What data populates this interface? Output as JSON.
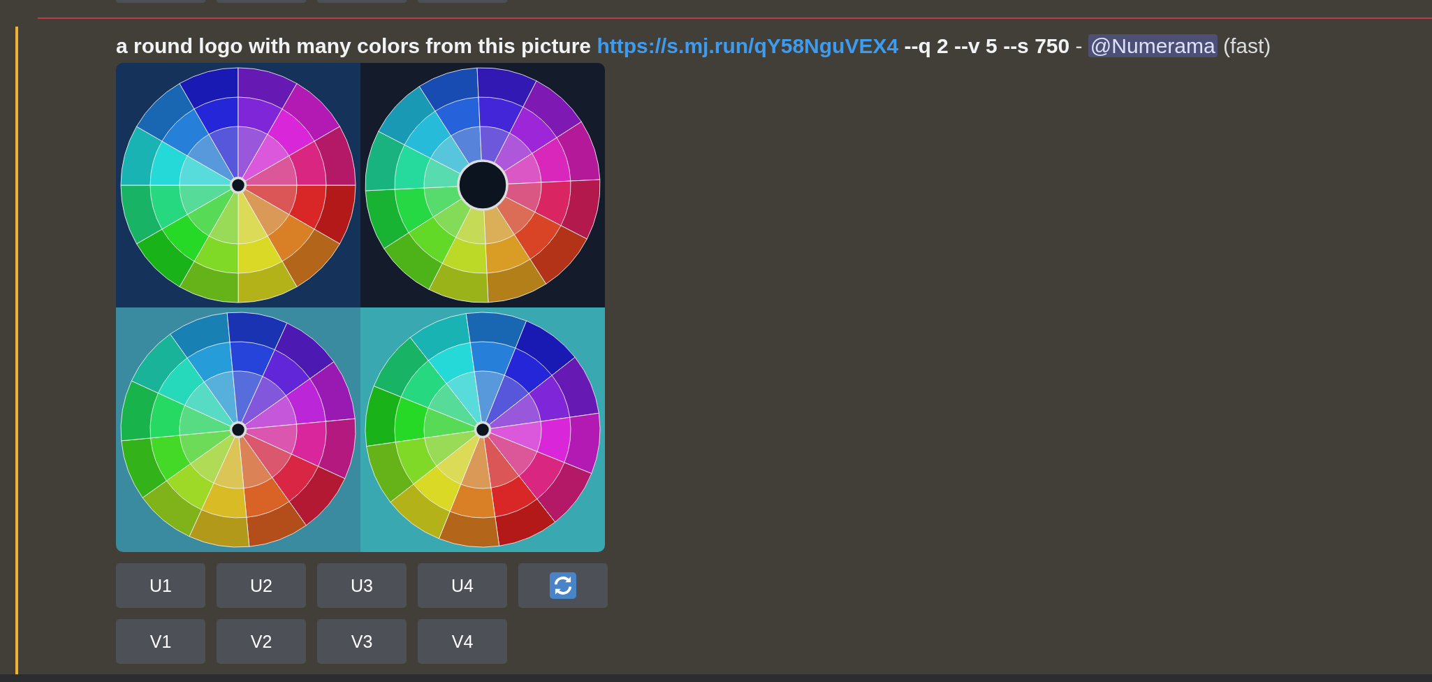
{
  "previous_message": {
    "buttons": [
      {
        "kind": "cut"
      },
      {
        "kind": "cut"
      },
      {
        "kind": "cut"
      },
      {
        "kind": "cut"
      }
    ]
  },
  "message": {
    "highlighted": true,
    "prompt": "a round logo with many colors from this picture",
    "link": "https://s.mj.run/qY58NguVEX4",
    "parameters": "--q 2 --v 5 --s 750",
    "separator": "-",
    "mention": "@Numerama",
    "speed": "(fast)",
    "images": [
      {
        "kind": "picture"
      },
      {
        "kind": "picture"
      },
      {
        "kind": "picture"
      },
      {
        "kind": "picture"
      }
    ],
    "button_rows": [
      [
        {
          "kind": "text",
          "label": "U1"
        },
        {
          "kind": "text",
          "label": "U2"
        },
        {
          "kind": "text",
          "label": "U3"
        },
        {
          "kind": "text",
          "label": "U4"
        },
        {
          "kind": "reroll"
        }
      ],
      [
        {
          "kind": "text",
          "label": "V1"
        },
        {
          "kind": "text",
          "label": "V2"
        },
        {
          "kind": "text",
          "label": "V3"
        },
        {
          "kind": "text",
          "label": "V4"
        }
      ]
    ]
  }
}
